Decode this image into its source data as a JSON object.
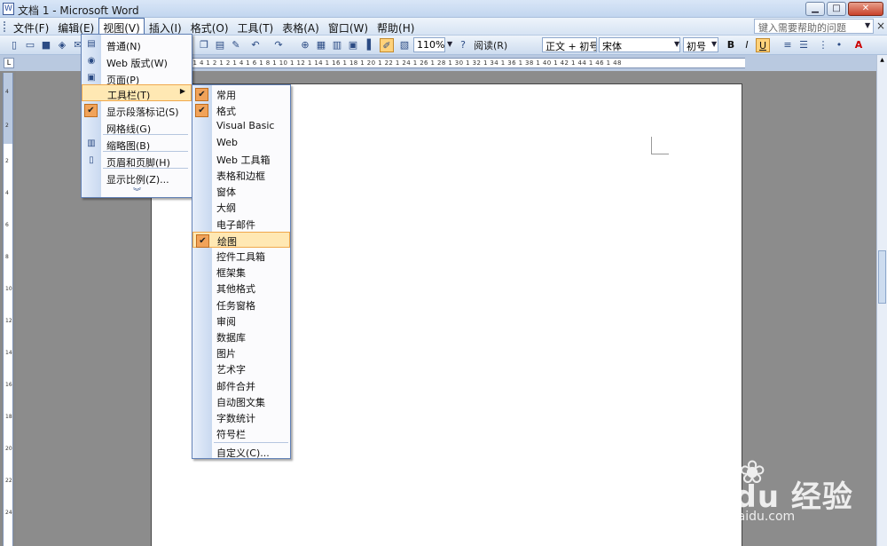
{
  "window": {
    "title": "文档 1 - Microsoft Word",
    "minimize": "▁",
    "maximize": "□",
    "close": "✕"
  },
  "menubar": {
    "items": [
      "文件(F)",
      "编辑(E)",
      "视图(V)",
      "插入(I)",
      "格式(O)",
      "工具(T)",
      "表格(A)",
      "窗口(W)",
      "帮助(H)"
    ],
    "help_placeholder": "键入需要帮助的问题",
    "close_doc": "×"
  },
  "toolbar": {
    "zoom": "110%",
    "read_label": "阅读(R)",
    "style": "正文 + 初号",
    "font": "宋体",
    "size": "初号",
    "bold": "B",
    "italic": "I",
    "underline": "U",
    "font_color": "A"
  },
  "ruler": {
    "h_text": "2 1 4 1 2 1 2 1 4 1 6 1 8 1 10 1 12 1 14 1 16 1 18 1 20 1 22 1 24 1 26 1 28 1 30 1 32 1 34 1 36 1 38 1 40 1 42 1 44 1 46 1 48",
    "v_labels": [
      "4",
      "2",
      "2",
      "4",
      "6",
      "8",
      "10",
      "12",
      "14",
      "16",
      "18",
      "20",
      "22",
      "24"
    ],
    "corner": "L"
  },
  "view_menu": {
    "items": [
      {
        "label": "普通(N)",
        "icon": "normal-view-icon"
      },
      {
        "label": "Web 版式(W)",
        "icon": "web-layout-icon"
      },
      {
        "label": "页面(P)",
        "icon": "page-layout-icon"
      },
      {
        "label": "工具栏(T)",
        "icon": "",
        "submenu": true
      },
      {
        "label": "显示段落标记(S)",
        "icon": "check-icon",
        "checked": true
      },
      {
        "label": "网格线(G)",
        "icon": ""
      },
      {
        "label": "缩略图(B)",
        "icon": "thumbnail-icon"
      },
      {
        "label": "页眉和页脚(H)",
        "icon": "header-footer-icon"
      },
      {
        "label": "显示比例(Z)...",
        "icon": ""
      }
    ],
    "more": "︾"
  },
  "toolbars_submenu": {
    "items": [
      {
        "label": "常用",
        "checked": true
      },
      {
        "label": "格式",
        "checked": true
      },
      {
        "label": "Visual Basic",
        "checked": false
      },
      {
        "label": "Web",
        "checked": false
      },
      {
        "label": "Web 工具箱",
        "checked": false
      },
      {
        "label": "表格和边框",
        "checked": false
      },
      {
        "label": "窗体",
        "checked": false
      },
      {
        "label": "大纲",
        "checked": false
      },
      {
        "label": "电子邮件",
        "checked": false
      },
      {
        "label": "绘图",
        "checked": true,
        "highlighted": true
      },
      {
        "label": "控件工具箱",
        "checked": false
      },
      {
        "label": "框架集",
        "checked": false
      },
      {
        "label": "其他格式",
        "checked": false
      },
      {
        "label": "任务窗格",
        "checked": false
      },
      {
        "label": "审阅",
        "checked": false
      },
      {
        "label": "数据库",
        "checked": false
      },
      {
        "label": "图片",
        "checked": false
      },
      {
        "label": "艺术字",
        "checked": false
      },
      {
        "label": "邮件合并",
        "checked": false
      },
      {
        "label": "自动图文集",
        "checked": false
      },
      {
        "label": "字数统计",
        "checked": false
      },
      {
        "label": "符号栏",
        "checked": false
      }
    ],
    "customize": "自定义(C)..."
  },
  "watermark": {
    "main": "Baidu 经验",
    "sub": "jingyan.baidu.com"
  },
  "colors": {
    "accent_highlight": "#ffe8b3",
    "check_orange": "#f1a35a",
    "menu_border": "#6281b6"
  }
}
